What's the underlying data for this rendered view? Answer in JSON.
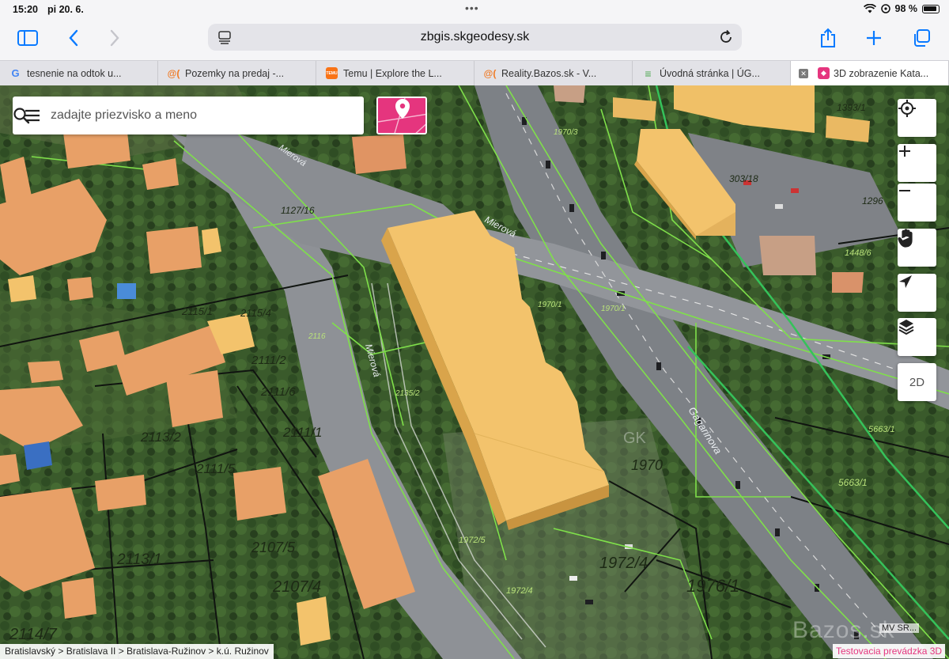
{
  "status_bar": {
    "time": "15:20",
    "date": "pi 20. 6.",
    "battery": "98 %",
    "dots": "•••"
  },
  "toolbar": {
    "url": "zbgis.skgeodesy.sk"
  },
  "tabs": [
    {
      "title": "tesnenie na odtok u...",
      "favicon": "G",
      "favicon_color": "#4285f4",
      "favicon_bg": "#ffffff"
    },
    {
      "title": "Pozemky na predaj -...",
      "favicon": "@(",
      "favicon_color": "#f07a24",
      "favicon_bg": "transparent"
    },
    {
      "title": "Temu | Explore the L...",
      "favicon": "TEMU",
      "favicon_color": "#ffffff",
      "favicon_bg": "#f97316"
    },
    {
      "title": "Reality.Bazos.sk - V...",
      "favicon": "@(",
      "favicon_color": "#f07a24",
      "favicon_bg": "transparent"
    },
    {
      "title": "Úvodná stránka | ÚG...",
      "favicon": "≡",
      "favicon_color": "#4aa64e",
      "favicon_bg": "transparent"
    },
    {
      "title": "3D zobrazenie Kata...",
      "favicon": "◆",
      "favicon_color": "#ffffff",
      "favicon_bg": "#e5357e",
      "active": true
    }
  ],
  "search": {
    "placeholder": "zadajte priezvisko a meno"
  },
  "map_controls": {
    "mode_2d_label": "2D"
  },
  "breadcrumb": "Bratislavský > Bratislava II > Bratislava-Ružinov > k.ú. Ružinov",
  "watermark": "Bazos.sk",
  "attribution": "MV SR...",
  "testing_banner": "Testovacia prevádzka 3D",
  "street_labels": [
    "Mierová",
    "Mierová",
    "Mierová",
    "Gagarinova"
  ],
  "parcel_labels": [
    "2111/2",
    "2111/6",
    "2111/1",
    "2113/2",
    "2111/5",
    "2107/5",
    "2113/1",
    "2107/4",
    "2114/7",
    "1970",
    "1972/4",
    "1976/1",
    "1127/16",
    "2115/1",
    "2115/4",
    "1393/1",
    "1296",
    "303/18",
    "1448/6",
    "5663/1",
    "5663/1",
    "1970/1",
    "1970/1",
    "1970/3",
    "2116",
    "2135/2",
    "1972/5",
    "1972/4",
    "GK"
  ],
  "colors": {
    "accent": "#0a7aff",
    "brand_pink": "#e5357e",
    "building_yellow": "#f3c36c",
    "building_orange": "#e8a067",
    "parcel_line_green": "#7fe04a",
    "vegetation": "#3b5a2c"
  }
}
